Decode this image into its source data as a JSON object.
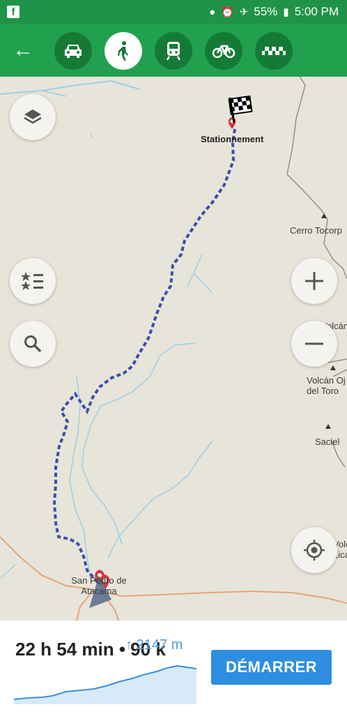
{
  "status_bar": {
    "battery": "55%",
    "time": "5:00 PM",
    "icons": [
      "facebook-icon",
      "location-icon",
      "alarm-icon",
      "airplane-mode-icon",
      "battery-icon"
    ]
  },
  "toolbar": {
    "back_icon": "arrow-back-icon",
    "modes": [
      {
        "name": "car",
        "icon": "car-icon",
        "active": false
      },
      {
        "name": "walk",
        "icon": "walking-icon",
        "active": true
      },
      {
        "name": "transit",
        "icon": "train-icon",
        "active": false
      },
      {
        "name": "bike",
        "icon": "bicycle-icon",
        "active": false
      },
      {
        "name": "taxi",
        "icon": "taxi-icon",
        "active": false
      }
    ]
  },
  "map": {
    "destination_label": "Stationnement",
    "origin_label": "San Pedro de Atacama",
    "places": [
      "Cerro Tocorp",
      "Volcán",
      "Volcán Oj del Toro",
      "Saciel",
      "Volcán Licancab"
    ],
    "route_color": "#3a4fa8"
  },
  "bottom": {
    "duration": "22 h 54 min",
    "distance": "• 90 k",
    "elevation": "↑ 2147 m",
    "start_button": "DÉMARRER"
  },
  "colors": {
    "toolbar": "#21a04e",
    "statusbar": "#1f9347",
    "accent": "#2e8ee0"
  }
}
